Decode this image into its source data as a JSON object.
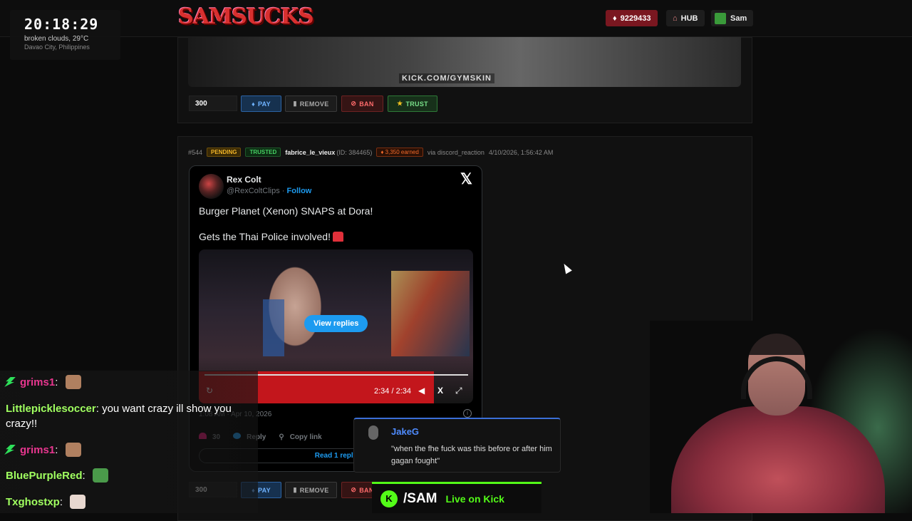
{
  "header": {
    "logo": "SAMSUCKS",
    "balance": "9229433",
    "hub_label": "HUB",
    "user_label": "Sam"
  },
  "clock": {
    "time": "20:18:29",
    "weather": "broken clouds, 29°C",
    "location": "Davao City, Philippines"
  },
  "card1": {
    "watermark": "KICK.COM/GYMSKIN",
    "amount": "300",
    "pay_label": "PAY",
    "remove_label": "REMOVE",
    "ban_label": "BAN",
    "trust_label": "TRUST"
  },
  "card2": {
    "id": "#544",
    "status_tag": "PENDING",
    "trust_tag": "TRUSTED",
    "username": "fabrice_le_vieux",
    "user_id": "(ID: 384465)",
    "earned": "3,350 earned",
    "source": "via discord_reaction",
    "timestamp": "4/10/2026, 1:56:42 AM",
    "amount": "300",
    "pay_label": "PAY",
    "remove_label": "REMOVE",
    "ban_label": "BAN"
  },
  "tweet": {
    "author": "Rex Colt",
    "handle": "@RexColtClips",
    "follow_label": "Follow",
    "text_line1": "Burger Planet (Xenon) SNAPS at Dora!",
    "text_line2": "Gets the Thai Police involved!",
    "view_replies_label": "View replies",
    "video_time": "2:34 / 2:34",
    "date": "1:08 AM · Apr 10, 2026",
    "likes": "30",
    "reply_label": "Reply",
    "copy_link_label": "Copy link",
    "read_replies_label": "Read 1 reply"
  },
  "chat": {
    "messages": [
      {
        "user": "grims1",
        "text": "",
        "color": "#e8368f"
      },
      {
        "user": "Littlepicklesoccer",
        "text": "you want crazy ill show you crazy!!",
        "color": "#a0ff60"
      },
      {
        "user": "grims1",
        "text": "",
        "color": "#e8368f"
      },
      {
        "user": "BluePurpleRed",
        "text": "",
        "color": "#a0ff60"
      },
      {
        "user": "Txghostxp",
        "text": "",
        "color": "#a0ff60"
      }
    ]
  },
  "tts": {
    "name": "JakeG",
    "message": "\"when the fhe fuck was this before or after him gagan fought\""
  },
  "kick_banner": {
    "channel": "/SAM",
    "status": "Live on Kick"
  },
  "colors": {
    "accent_red": "#d8302f",
    "kick_green": "#53fc18",
    "twitter_blue": "#1d9bf0"
  }
}
